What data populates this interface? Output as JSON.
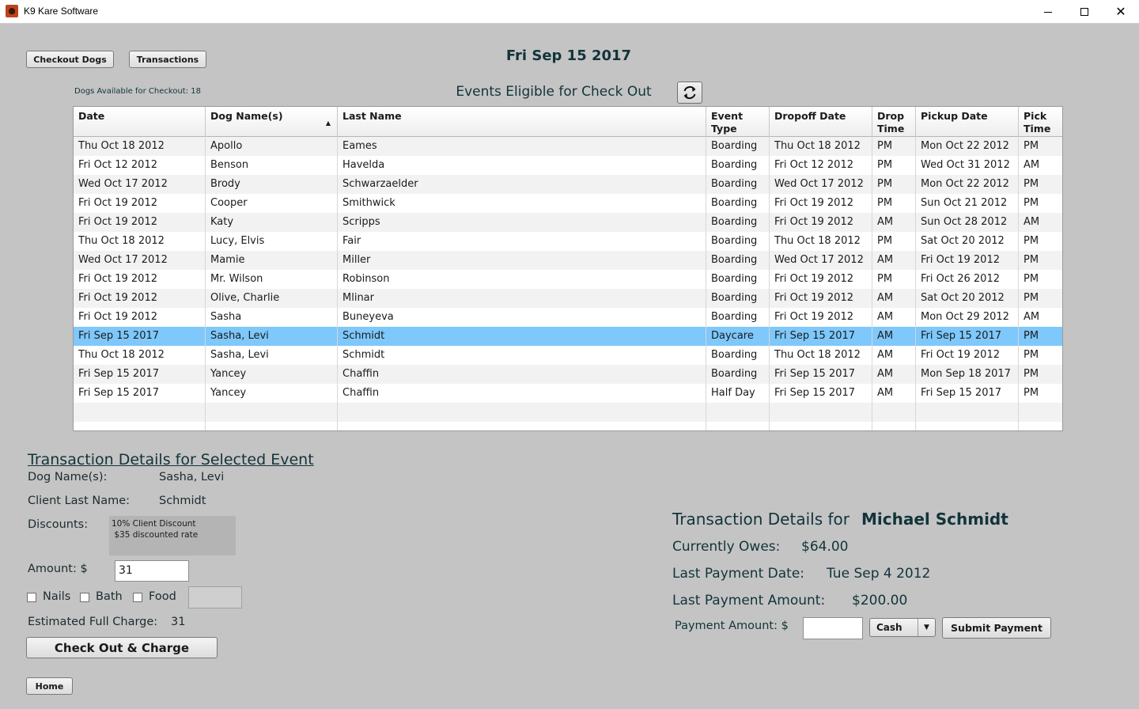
{
  "window": {
    "title": "K9 Kare Software",
    "minimize_icon": "minimize-icon",
    "maximize_icon": "maximize-icon",
    "close_icon": "close-icon"
  },
  "toolbar": {
    "checkout_dogs_label": "Checkout Dogs",
    "transactions_label": "Transactions",
    "page_date": "Fri Sep 15 2017"
  },
  "events": {
    "available_text": "Dogs Available for Checkout: 18",
    "title": "Events Eligible for Check Out",
    "refresh_icon": "refresh-icon",
    "columns": [
      "Date",
      "Dog Name(s)",
      "Last Name",
      "Event Type",
      "Dropoff Date",
      "Drop Time",
      "Pickup Date",
      "Pick Time"
    ],
    "sorted_column": 1,
    "selected_row": 10,
    "rows": [
      [
        "Thu Oct 18 2012",
        "Apollo",
        "Eames",
        "Boarding",
        "Thu Oct 18 2012",
        "PM",
        "Mon Oct 22 2012",
        "PM"
      ],
      [
        "Fri Oct 12 2012",
        "Benson",
        "Havelda",
        "Boarding",
        "Fri Oct 12 2012",
        "PM",
        "Wed Oct 31 2012",
        "AM"
      ],
      [
        "Wed Oct 17 2012",
        "Brody",
        "Schwarzaelder",
        "Boarding",
        "Wed Oct 17 2012",
        "PM",
        "Mon Oct 22 2012",
        "PM"
      ],
      [
        "Fri Oct 19 2012",
        "Cooper",
        "Smithwick",
        "Boarding",
        "Fri Oct 19 2012",
        "PM",
        "Sun Oct 21 2012",
        "PM"
      ],
      [
        "Fri Oct 19 2012",
        "Katy",
        "Scripps",
        "Boarding",
        "Fri Oct 19 2012",
        "AM",
        "Sun Oct 28 2012",
        "AM"
      ],
      [
        "Thu Oct 18 2012",
        "Lucy, Elvis",
        "Fair",
        "Boarding",
        "Thu Oct 18 2012",
        "PM",
        "Sat Oct 20 2012",
        "PM"
      ],
      [
        "Wed Oct 17 2012",
        "Mamie",
        "Miller",
        "Boarding",
        "Wed Oct 17 2012",
        "AM",
        "Fri Oct 19 2012",
        "PM"
      ],
      [
        "Fri Oct 19 2012",
        "Mr. Wilson",
        "Robinson",
        "Boarding",
        "Fri Oct 19 2012",
        "PM",
        "Fri Oct 26 2012",
        "PM"
      ],
      [
        "Fri Oct 19 2012",
        "Olive, Charlie",
        "Mlinar",
        "Boarding",
        "Fri Oct 19 2012",
        "AM",
        "Sat Oct 20 2012",
        "PM"
      ],
      [
        "Fri Oct 19 2012",
        "Sasha",
        "Buneyeva",
        "Boarding",
        "Fri Oct 19 2012",
        "AM",
        "Mon Oct 29 2012",
        "AM"
      ],
      [
        "Fri Sep 15 2017",
        "Sasha, Levi",
        "Schmidt",
        "Daycare",
        "Fri Sep 15 2017",
        "AM",
        "Fri Sep 15 2017",
        "PM"
      ],
      [
        "Thu Oct 18 2012",
        "Sasha, Levi",
        "Schmidt",
        "Boarding",
        "Thu Oct 18 2012",
        "AM",
        "Fri Oct 19 2012",
        "PM"
      ],
      [
        "Fri Sep 15 2017",
        "Yancey",
        "Chaffin",
        "Boarding",
        "Fri Sep 15 2017",
        "AM",
        "Mon Sep 18 2017",
        "PM"
      ],
      [
        "Fri Sep 15 2017",
        "Yancey",
        "Chaffin",
        "Half Day",
        "Fri Sep 15 2017",
        "AM",
        "Fri Sep 15 2017",
        "PM"
      ],
      [
        "",
        "",
        "",
        "",
        "",
        "",
        "",
        ""
      ],
      [
        "",
        "",
        "",
        "",
        "",
        "",
        "",
        ""
      ]
    ]
  },
  "details": {
    "title": "Transaction Details for Selected Event",
    "dog_names_label": "Dog Name(s):",
    "dog_names_value": "Sasha, Levi",
    "client_last_name_label": "Client Last Name:",
    "client_last_name_value": "Schmidt",
    "discounts_label": "Discounts:",
    "discount_lines": [
      "10% Client Discount",
      " $35 discounted rate"
    ],
    "amount_label": "Amount: $",
    "amount_value": "31",
    "nails_label": "Nails",
    "bath_label": "Bath",
    "food_label": "Food",
    "food_value": "",
    "estimated_label": "Estimated Full Charge:",
    "estimated_value": "31",
    "checkout_label": "Check Out & Charge",
    "home_label": "Home"
  },
  "client": {
    "title_prefix": "Transaction Details for",
    "name": "Michael Schmidt",
    "owes_label": "Currently Owes:",
    "owes_value": "$64.00",
    "last_payment_date_label": "Last Payment Date:",
    "last_payment_date_value": "Tue Sep 4 2012",
    "last_payment_amount_label": "Last Payment Amount:",
    "last_payment_amount_value": "$200.00",
    "payment_amount_label": "Payment Amount: $",
    "payment_amount_value": "",
    "payment_method": "Cash",
    "submit_label": "Submit Payment"
  },
  "colors": {
    "background": "#c4c4c4",
    "selected_row": "#7ec8fb",
    "heading_text": "#12343a"
  }
}
